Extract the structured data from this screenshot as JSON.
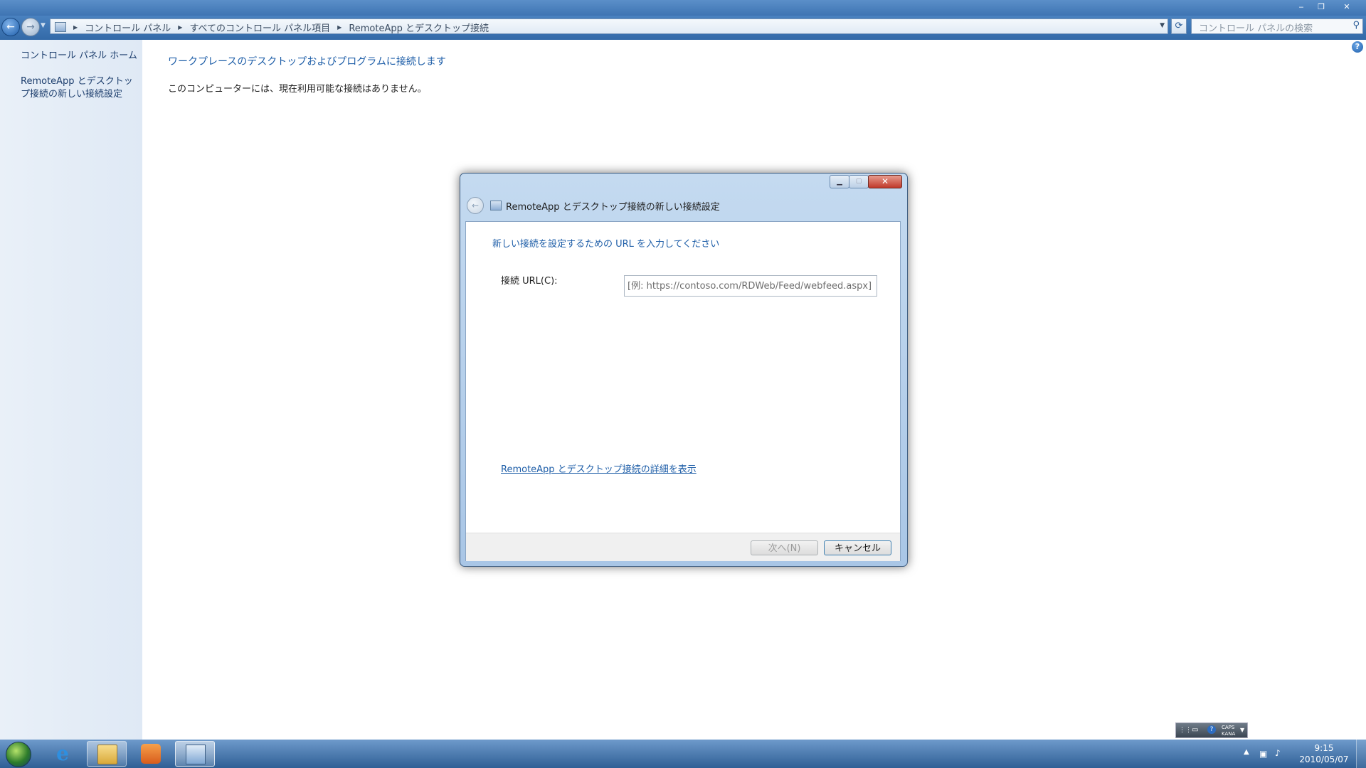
{
  "window": {
    "minimize": "‒",
    "restore": "❐",
    "close": "✕"
  },
  "address": {
    "crumbs": [
      "コントロール パネル",
      "すべてのコントロール パネル項目",
      "RemoteApp とデスクトップ接続"
    ],
    "search_placeholder": "コントロール パネルの検索"
  },
  "sidebar": {
    "items": [
      {
        "label": "コントロール パネル ホーム"
      },
      {
        "label": "RemoteApp とデスクトップ接続の新しい接続設定"
      }
    ]
  },
  "main": {
    "heading": "ワークプレースのデスクトップおよびプログラムに接続します",
    "message": "このコンピューターには、現在利用可能な接続はありません。"
  },
  "dialog": {
    "title": "RemoteApp とデスクトップ接続の新しい接続設定",
    "instruction": "新しい接続を設定するための URL を入力してください",
    "url_label": "接続 URL(C):",
    "url_value": "",
    "url_placeholder": "[例: https://contoso.com/RDWeb/Feed/webfeed.aspx]",
    "more_link": "RemoteApp とデスクトップ接続の詳細を表示",
    "next_label": "次へ(N)",
    "cancel_label": "キャンセル"
  },
  "taskbar": {
    "pinned": [
      "internet-explorer-icon",
      "windows-explorer-icon",
      "media-player-icon",
      "control-panel-icon"
    ],
    "language_bar": {
      "caps": "CAPS",
      "kana": "KANA"
    },
    "clock": {
      "time": "9:15",
      "date": "2010/05/07"
    }
  },
  "colors": {
    "link": "#1e5ea8",
    "titlebar": "#3e74b3",
    "taskbar": "#2f5f95"
  }
}
